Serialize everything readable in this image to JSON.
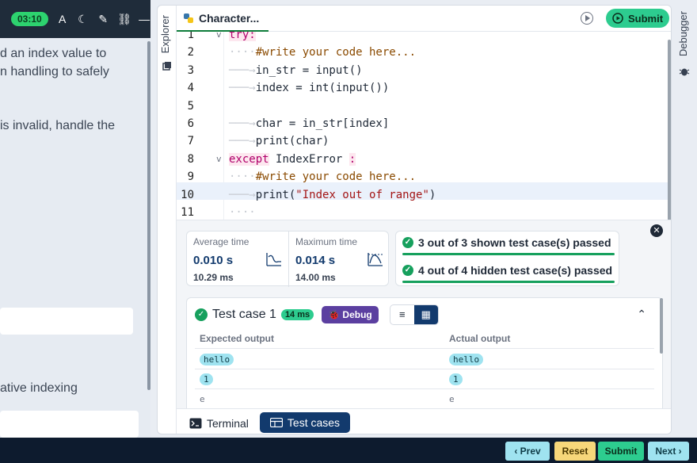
{
  "timer": "03:10",
  "problem": {
    "lines": [
      "d an index value to",
      "n handling to safely",
      "is invalid, handle the",
      "ative indexing"
    ]
  },
  "editor": {
    "tab_title": "Character...",
    "submit_label": "Submit",
    "explorer_label": "Explorer",
    "debugger_label": "Debugger",
    "line_numbers": [
      "1",
      "2",
      "3",
      "4",
      "5",
      "6",
      "7",
      "8",
      "9",
      "10",
      "11"
    ],
    "code": {
      "l1": "try:",
      "l2": "#write your code here...",
      "l3": "in_str = input()",
      "l4": "index = int(input())",
      "l6": "char = in_str[index]",
      "l7": "print(char)",
      "l8_kw": "except",
      "l8_rest": "IndexError",
      "l8_colon": ":",
      "l9": "#write your code here...",
      "l10_pre": "print(",
      "l10_str": "\"Index out of range\"",
      "l10_post": ")"
    }
  },
  "results": {
    "avg_label": "Average time",
    "avg_value": "0.010 s",
    "avg_sub": "10.29 ms",
    "max_label": "Maximum time",
    "max_value": "0.014 s",
    "max_sub": "14.00 ms",
    "shown_passed": "3 out of 3 shown test case(s) passed",
    "hidden_passed": "4 out of 4 hidden test case(s) passed",
    "testcase": {
      "title": "Test case 1",
      "time": "14 ms",
      "debug_label": "Debug",
      "expected_header": "Expected output",
      "actual_header": "Actual output",
      "expected": [
        "hello",
        "1",
        "e"
      ],
      "actual": [
        "hello",
        "1",
        "e"
      ]
    }
  },
  "bottom_tabs": {
    "terminal": "Terminal",
    "testcases": "Test cases"
  },
  "nav": {
    "prev": "‹ Prev",
    "reset": "Reset",
    "submit": "Submit",
    "next": "Next ›"
  }
}
